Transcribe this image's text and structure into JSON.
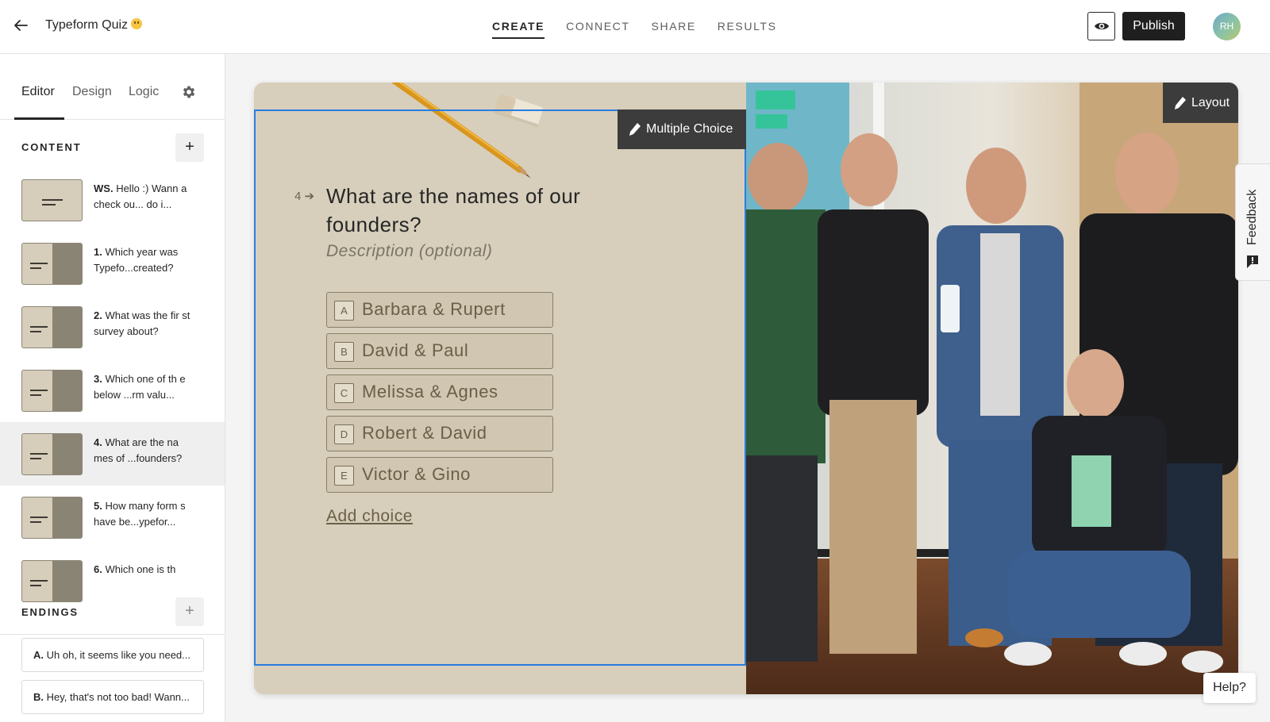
{
  "header": {
    "form_title": "Typeform Quiz",
    "nav_tabs": [
      {
        "label": "CREATE",
        "active": true
      },
      {
        "label": "CONNECT",
        "active": false
      },
      {
        "label": "SHARE",
        "active": false
      },
      {
        "label": "RESULTS",
        "active": false
      }
    ],
    "publish_label": "Publish",
    "avatar_initials": "RH"
  },
  "sidebar": {
    "tabs": [
      {
        "label": "Editor",
        "active": true
      },
      {
        "label": "Design",
        "active": false
      },
      {
        "label": "Logic",
        "active": false
      }
    ],
    "content_label": "CONTENT",
    "questions": [
      {
        "num": "WS.",
        "text": "Hello :) Wann a check ou... do i...",
        "layout": "full"
      },
      {
        "num": "1.",
        "text": "Which year was Typefo...created?",
        "layout": "split"
      },
      {
        "num": "2.",
        "text": "What was the fir st survey about?",
        "layout": "split"
      },
      {
        "num": "3.",
        "text": "Which one of th e below ...rm valu...",
        "layout": "split"
      },
      {
        "num": "4.",
        "text": "What are the na mes of ...founders?",
        "layout": "split",
        "selected": true
      },
      {
        "num": "5.",
        "text": "How many form s have be...ypefor...",
        "layout": "split"
      },
      {
        "num": "6.",
        "text": "Which one is th",
        "layout": "split"
      }
    ],
    "endings_label": "ENDINGS",
    "endings": [
      {
        "key": "A.",
        "text": "Uh oh, it seems like you need..."
      },
      {
        "key": "B.",
        "text": "Hey, that's not too bad! Wann..."
      }
    ]
  },
  "canvas": {
    "type_chip_label": "Multiple Choice",
    "layout_chip_label": "Layout",
    "question_number": "4",
    "question_title": "What are the names of our founders?",
    "description_placeholder": "Description (optional)",
    "choices": [
      {
        "key": "A",
        "label": "Barbara & Rupert"
      },
      {
        "key": "B",
        "label": "David & Paul"
      },
      {
        "key": "C",
        "label": "Melissa & Agnes"
      },
      {
        "key": "D",
        "label": "Robert & David"
      },
      {
        "key": "E",
        "label": "Victor & Gino"
      }
    ],
    "add_choice_label": "Add choice",
    "theme": {
      "background": "#d7cfbb",
      "answer_color": "#6b5f47",
      "selection_border": "#2a7de1"
    }
  },
  "feedback_label": "Feedback",
  "help_label": "Help?"
}
